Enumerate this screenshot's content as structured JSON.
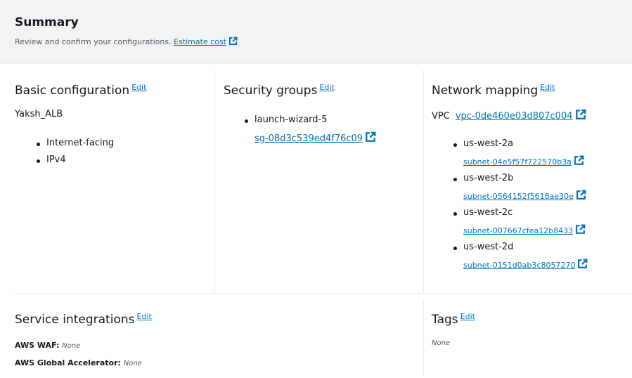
{
  "summary": {
    "title": "Summary",
    "subtitle": "Review and confirm your configurations.",
    "estimate_link": "Estimate cost"
  },
  "edit_label": "Edit",
  "basic": {
    "title": "Basic configuration",
    "name": "Yaksh_ALB",
    "items": [
      "Internet-facing",
      "IPv4"
    ]
  },
  "security": {
    "title": "Security groups",
    "group_name": "launch-wizard-5",
    "group_id": "sg-08d3c539ed4f76c09"
  },
  "network": {
    "title": "Network mapping",
    "vpc_label": "VPC",
    "vpc_id": "vpc-0de460e03d807c004",
    "zones": [
      {
        "name": "us-west-2a",
        "subnet": "subnet-04e5f57f722570b3a"
      },
      {
        "name": "us-west-2b",
        "subnet": "subnet-0564152f5618ae30e"
      },
      {
        "name": "us-west-2c",
        "subnet": "subnet-007667cfea12b8433"
      },
      {
        "name": "us-west-2d",
        "subnet": "subnet-0151d0ab3c8057270"
      }
    ]
  },
  "services": {
    "title": "Service integrations",
    "waf_label": "AWS WAF:",
    "waf_value": "None",
    "ga_label": "AWS Global Accelerator:",
    "ga_value": "None"
  },
  "tags": {
    "title": "Tags",
    "value": "None"
  },
  "colors": {
    "link": "#0073bb",
    "header_bg": "#f2f3f3",
    "text": "#16191f"
  },
  "icons": {
    "external": "external-link-icon"
  }
}
